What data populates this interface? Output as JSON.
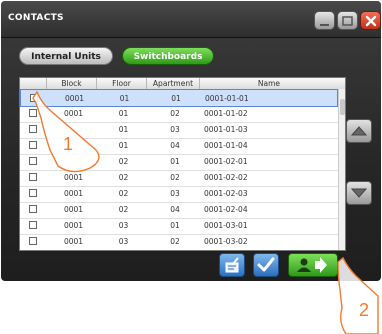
{
  "window": {
    "title": "CONTACTS"
  },
  "tabs": [
    {
      "label": "Internal Units"
    },
    {
      "label": "Switchboards"
    }
  ],
  "table": {
    "columns": [
      "Block",
      "Floor",
      "Apartment",
      "Name"
    ],
    "rows": [
      {
        "block": "0001",
        "floor": "01",
        "apartment": "01",
        "name": "0001-01-01",
        "selected": true
      },
      {
        "block": "0001",
        "floor": "01",
        "apartment": "02",
        "name": "0001-01-02"
      },
      {
        "block": "",
        "floor": "01",
        "apartment": "03",
        "name": "0001-01-03"
      },
      {
        "block": "",
        "floor": "01",
        "apartment": "04",
        "name": "0001-01-04"
      },
      {
        "block": "",
        "floor": "02",
        "apartment": "01",
        "name": "0001-02-01"
      },
      {
        "block": "0001",
        "floor": "02",
        "apartment": "02",
        "name": "0001-02-02"
      },
      {
        "block": "0001",
        "floor": "02",
        "apartment": "03",
        "name": "0001-02-03"
      },
      {
        "block": "0001",
        "floor": "02",
        "apartment": "04",
        "name": "0001-02-04"
      },
      {
        "block": "0001",
        "floor": "03",
        "apartment": "01",
        "name": "0001-03-01"
      },
      {
        "block": "0001",
        "floor": "03",
        "apartment": "02",
        "name": "0001-03-02"
      }
    ]
  },
  "annotations": {
    "callout_1": "1",
    "callout_2": "2"
  },
  "icons": {
    "minimize": "minimize-icon",
    "maximize": "maximize-icon",
    "close": "close-icon",
    "scroll_up": "arrow-up-icon",
    "scroll_down": "arrow-down-icon",
    "edit": "edit-list-icon",
    "confirm": "checkmark-icon",
    "call": "contact-call-icon"
  },
  "colors": {
    "accent_green": "#3aa81f",
    "accent_blue": "#2a6fc0",
    "close_red": "#d6391f",
    "callout": "#f27a2d"
  }
}
